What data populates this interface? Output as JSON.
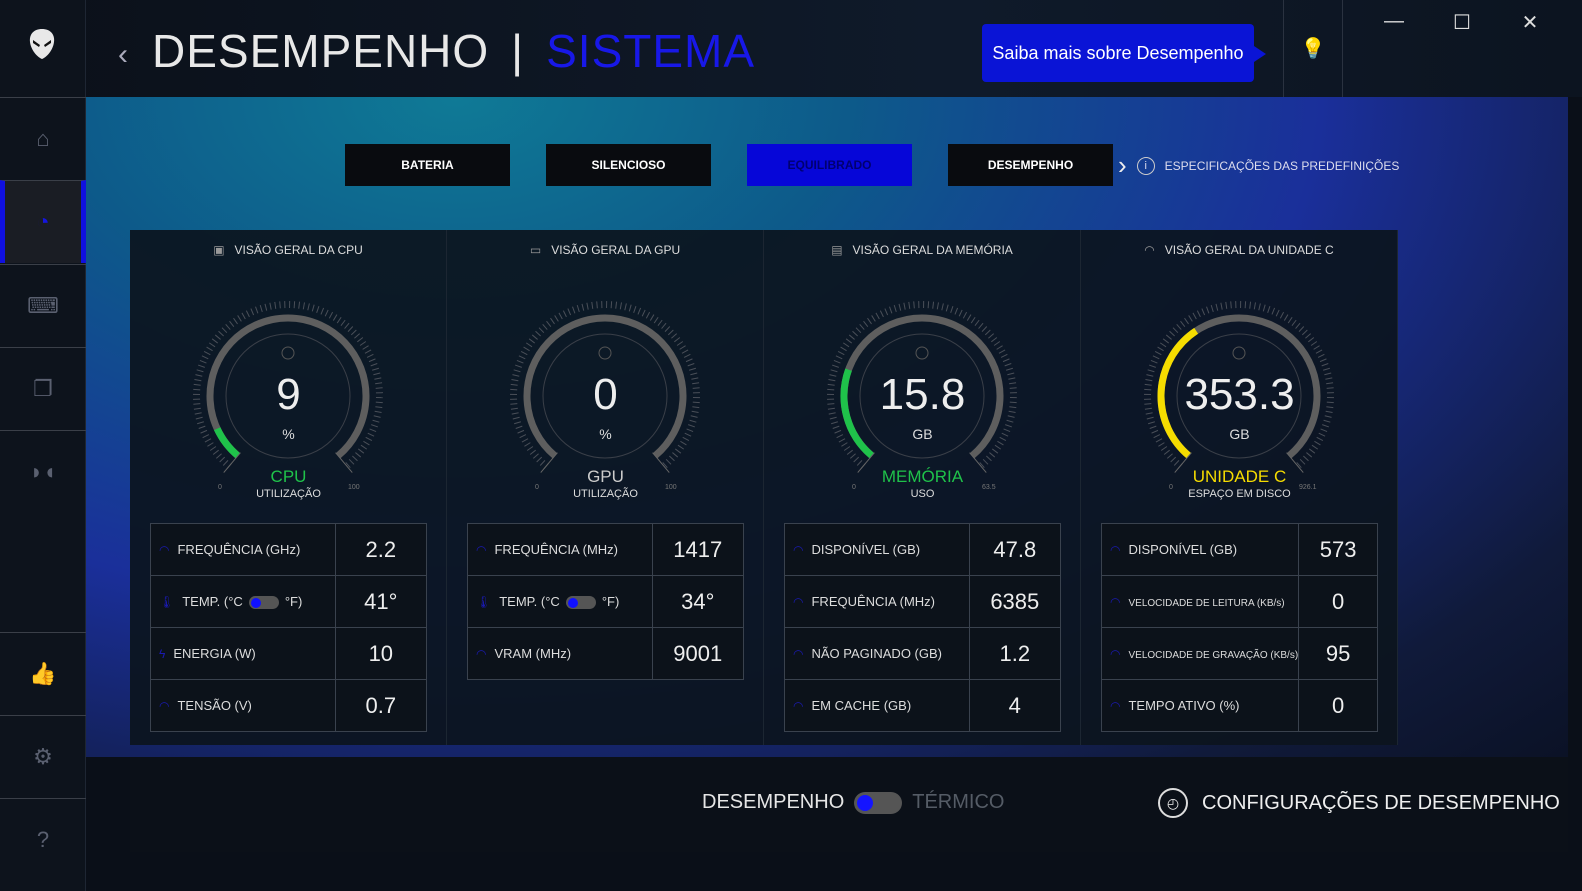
{
  "header": {
    "title": "DESEMPENHO",
    "separator": "|",
    "subtitle": "SISTEMA",
    "back_icon": "chevron-left-icon",
    "tip": "Saiba mais sobre Desempenho",
    "bulb_icon": "lightbulb-icon"
  },
  "window": {
    "minimize": "—",
    "maximize": "☐",
    "close": "✕"
  },
  "sidebar": {
    "items": [
      {
        "name": "home",
        "icon": "⌂"
      },
      {
        "name": "performance",
        "icon": "◔",
        "active": true
      },
      {
        "name": "peripherals",
        "icon": "⌨"
      },
      {
        "name": "library",
        "icon": "❐"
      },
      {
        "name": "dolby",
        "icon": "◗◖"
      },
      {
        "name": "feedback",
        "icon": "👍"
      },
      {
        "name": "settings",
        "icon": "⚙"
      },
      {
        "name": "help",
        "icon": "?"
      }
    ]
  },
  "presets": {
    "items": [
      "BATERIA",
      "SILENCIOSO",
      "EQUILIBRADO",
      "DESEMPENHO"
    ],
    "active": "EQUILIBRADO",
    "specs_label": "ESPECIFICAÇÕES DAS PREDEFINIÇÕES"
  },
  "colors": {
    "accent": "#0606d8",
    "cpu": "#1fc24a",
    "memory": "#1fc24a",
    "disk": "#f5dc00",
    "track": "#5e5e5e"
  },
  "panels": [
    {
      "title": "VISÃO GERAL DA CPU",
      "icon": "▣",
      "value": "9",
      "unit": "%",
      "name": "CPU",
      "sub": "UTILIZAÇÃO",
      "min": "0",
      "max": "100",
      "fraction": 0.09,
      "color": "#1fc24a",
      "name_color": "#1fc24a",
      "rows": [
        {
          "label": "FREQUÊNCIA (GHz)",
          "value": "2.2",
          "icon": "gauge-icon"
        },
        {
          "label": "TEMP. (°C",
          "label2": "°F)",
          "toggle": true,
          "value": "41°",
          "icon": "thermometer-icon"
        },
        {
          "label": "ENERGIA (W)",
          "value": "10",
          "icon": "lightning-icon"
        },
        {
          "label": "TENSÃO (V)",
          "value": "0.7",
          "icon": "gauge-icon"
        }
      ]
    },
    {
      "title": "VISÃO GERAL DA GPU",
      "icon": "▭",
      "value": "0",
      "unit": "%",
      "name": "GPU",
      "sub": "UTILIZAÇÃO",
      "min": "0",
      "max": "100",
      "fraction": 0,
      "color": "#1fc24a",
      "name_color": "#cccccc",
      "rows": [
        {
          "label": "FREQUÊNCIA (MHz)",
          "value": "1417",
          "icon": "gauge-icon"
        },
        {
          "label": "TEMP. (°C",
          "label2": "°F)",
          "toggle": true,
          "value": "34°",
          "icon": "thermometer-icon"
        },
        {
          "label": "VRAM (MHz)",
          "value": "9001",
          "icon": "gauge-icon"
        }
      ]
    },
    {
      "title": "VISÃO GERAL DA MEMÓRIA",
      "icon": "▤",
      "value": "15.8",
      "unit": "GB",
      "name": "MEMÓRIA",
      "sub": "USO",
      "min": "0",
      "max": "63.5",
      "fraction": 0.249,
      "color": "#1fc24a",
      "name_color": "#1fc24a",
      "rows": [
        {
          "label": "DISPONÍVEL (GB)",
          "value": "47.8",
          "icon": "gauge-icon"
        },
        {
          "label": "FREQUÊNCIA (MHz)",
          "value": "6385",
          "icon": "gauge-icon"
        },
        {
          "label": "NÃO PAGINADO (GB)",
          "value": "1.2",
          "icon": "gauge-icon"
        },
        {
          "label": "EM CACHE (GB)",
          "value": "4",
          "icon": "gauge-icon"
        }
      ]
    },
    {
      "title": "VISÃO GERAL DA UNIDADE C",
      "icon": "◠",
      "value": "353.3",
      "unit": "GB",
      "name": "UNIDADE C",
      "sub": "ESPAÇO EM DISCO",
      "min": "0",
      "max": "926.1",
      "fraction": 0.381,
      "color": "#f5dc00",
      "name_color": "#f5dc00",
      "rows": [
        {
          "label": "DISPONÍVEL (GB)",
          "value": "573",
          "icon": "gauge-icon"
        },
        {
          "label": "VELOCIDADE DE LEITURA (KB/s)",
          "value": "0",
          "small": true,
          "icon": "gauge-icon"
        },
        {
          "label": "VELOCIDADE DE GRAVAÇÃO (KB/s)",
          "value": "95",
          "small": true,
          "icon": "gauge-icon"
        },
        {
          "label": "TEMPO ATIVO (%)",
          "value": "0",
          "icon": "gauge-icon"
        }
      ]
    }
  ],
  "footer": {
    "mode_on": "DESEMPENHO",
    "mode_off": "TÉRMICO",
    "config": "CONFIGURAÇÕES DE DESEMPENHO"
  }
}
